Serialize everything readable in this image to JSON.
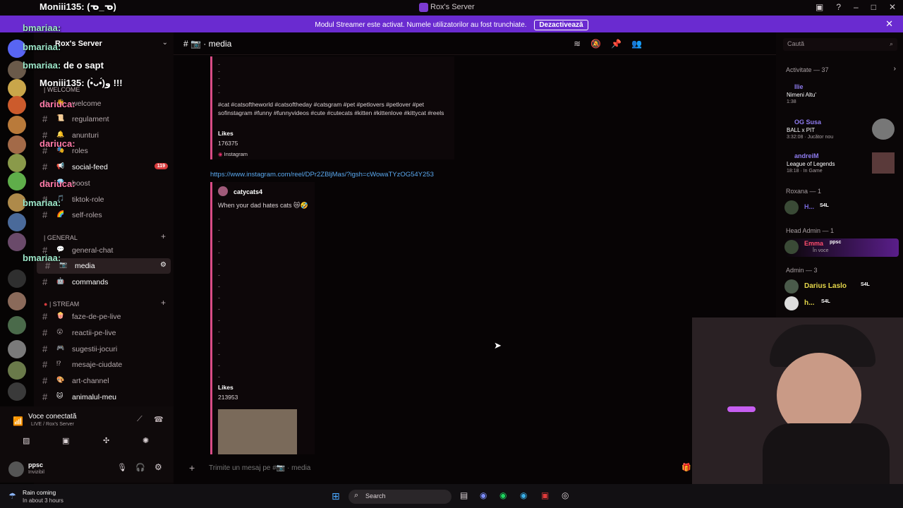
{
  "window": {
    "title": "Rox's Server"
  },
  "banner": {
    "text": "Modul Streamer este activat. Numele utilizatorilor au fost trunchiate.",
    "button": "Dezactivează"
  },
  "server": {
    "name": "Rox's Server"
  },
  "overlay_chat": [
    {
      "user": "Moniii135:",
      "text": "(ᓀ_ᓀ)",
      "color": "#fff"
    },
    {
      "user": "bmariaa:",
      "text": "",
      "color": "#9ce6c8"
    },
    {
      "user": "bmariaa:",
      "text": "",
      "color": "#9ce6c8"
    },
    {
      "user": "bmariaa:",
      "text": "de o sapt",
      "color": "#9ce6c8"
    },
    {
      "user": "Moniii135:",
      "text": "(•̀ᴗ•́)و !!!",
      "color": "#fff"
    },
    {
      "user": "dariuca:",
      "text": "",
      "color": "#ff7aa8"
    },
    {
      "user": "dariuca:",
      "text": "",
      "color": "#ff7aa8"
    },
    {
      "user": "dariuca:",
      "text": "",
      "color": "#ff7aa8"
    },
    {
      "user": "bmariaa:",
      "text": "",
      "color": "#9ce6c8"
    },
    {
      "user": "bmariaa:",
      "text": "",
      "color": "#9ce6c8"
    }
  ],
  "channels": {
    "welcome_category": "| WELCOME",
    "general_category": "| GENERAL",
    "stream_category": "| STREAM",
    "items": [
      {
        "name": "welcome",
        "icon": "👋"
      },
      {
        "name": "regulament",
        "icon": "📜"
      },
      {
        "name": "anunturi",
        "icon": "🔔"
      },
      {
        "name": "roles",
        "icon": "🎭"
      },
      {
        "name": "social-feed",
        "icon": "📢",
        "badge": "119"
      },
      {
        "name": "boost",
        "icon": "💎"
      },
      {
        "name": "tiktok-role",
        "icon": "🎵"
      },
      {
        "name": "self-roles",
        "icon": "🌈"
      },
      {
        "name": "general-chat",
        "icon": "💬"
      },
      {
        "name": "media",
        "icon": "📷"
      },
      {
        "name": "commands",
        "icon": "🤖"
      }
    ],
    "stream_items": [
      {
        "name": "faze-de-pe-live",
        "icon": "🍿"
      },
      {
        "name": "reactii-pe-live",
        "icon": "😮"
      },
      {
        "name": "sugestii-jocuri",
        "icon": "🎮"
      },
      {
        "name": "mesaje-ciudate",
        "icon": "⁉"
      },
      {
        "name": "art-channel",
        "icon": "🎨"
      },
      {
        "name": "animalul-meu",
        "icon": "🐱"
      }
    ]
  },
  "voice": {
    "status": "Voce conectată",
    "location": "LIVE / Rox's Server"
  },
  "user": {
    "name": "ppsc",
    "status": "Invizibil"
  },
  "header": {
    "channel": "media",
    "search_placeholder": "Caută"
  },
  "messages": {
    "post1_hashtags": "#cat #catsoftheworld #catsoftheday #catsgram #pet #petlovers #petlover #pet sofinstagram #funny #funnyvideos #cute #cutecats #kitten #kittenlove #kittycat #reels",
    "post1_likes_label": "Likes",
    "post1_likes": "176375",
    "post1_source": "Instagram",
    "link": "https://www.instagram.com/reel/DPr2ZBljMas/?igsh=cWowaTYzOG54Y253",
    "post2_author": "catycats4",
    "post2_text": "When your dad hates cats 😿🤣",
    "post2_likes_label": "Likes",
    "post2_likes": "213953"
  },
  "composer": {
    "placeholder": "Trimite un mesaj pe #📷 · media"
  },
  "members": {
    "activity_header": "Activitate — 37",
    "activities": [
      {
        "name": "Ilie",
        "line1": "Nimeni Altu'",
        "line2": "1:38",
        "color": "#8f7cf0"
      },
      {
        "name": "OG Susa",
        "line1": "BALL x PIT",
        "line2": "3:32:08 · Jucător nou",
        "color": "#8f7cf0"
      },
      {
        "name": "andreiM",
        "line1": "League of Legends",
        "line2": "18:18 · In Game",
        "color": "#8f7cf0"
      }
    ],
    "roxana_header": "Roxana — 1",
    "roxana_member": "H...",
    "head_admin_header": "Head Admin — 1",
    "head_admin_member": "Emma",
    "head_admin_tag": "ppsc",
    "head_admin_sub": "În voce",
    "admin_header": "Admin — 3",
    "admin_members": [
      {
        "name": "Darius Laslo",
        "tag": "S4L",
        "color": "#e6d84b"
      },
      {
        "name": "h...",
        "tag": "S4L",
        "color": "#e6d84b"
      }
    ],
    "tag_s4l": "S4L"
  },
  "taskbar": {
    "weather_title": "Rain coming",
    "weather_sub": "In about 3 hours",
    "search": "Search"
  }
}
